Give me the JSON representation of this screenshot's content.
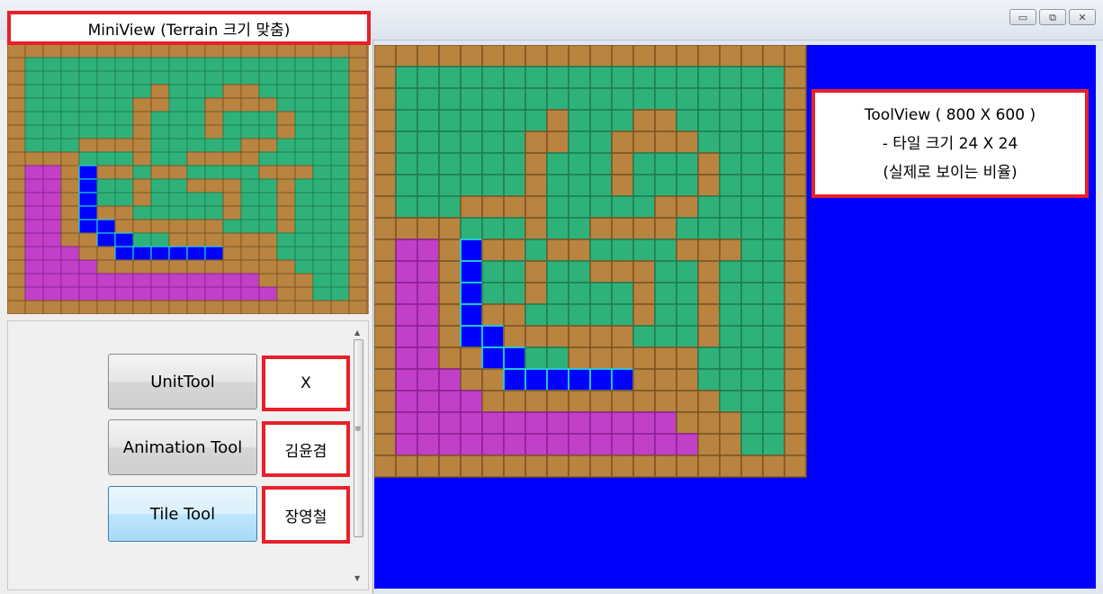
{
  "window": {
    "minimize_glyph": "▭",
    "restore_glyph": "⧉",
    "close_glyph": "✕"
  },
  "mini_label": "MiniView (Terrain 크기 맞춤)",
  "tool_view_label": {
    "line1": "ToolView ( 800 X 600 )",
    "line2": "- 타일 크기 24 X 24",
    "line3": "(실제로 보이는 비율)"
  },
  "tools": [
    {
      "label": "UnitTool",
      "owner": "X",
      "active": false
    },
    {
      "label": "Animation Tool",
      "owner": "김윤겸",
      "active": false
    },
    {
      "label": "Tile Tool",
      "owner": "장영철",
      "active": true
    }
  ],
  "map": {
    "cols": 20,
    "rows": 20,
    "rows_data": [
      "DDDDDDDDDDDDDDDDDDDD",
      "DGGGGGGGGGGGGGGGGGGD",
      "DGGGGGGGGGGGGGGGGGGD",
      "DGGGGGGGDGGGDDGGGGGD",
      "DGGGGGGDDGGDDDDGGGGD",
      "DGGGGGGDGGGDGGGDGGGD",
      "DGGGGGGDGGGDGGGDGGGD",
      "DGGGDDDDGGGGGDDGGGGD",
      "DDDDGGGDGGDDDDGGGGGD",
      "DMMDBDDGDDGGGGDDDGGD",
      "DMMDBGGDGGDDDGGDGGGD",
      "DMMDBGGDGGGGDGGDGGGD",
      "DMMDBDDGGGGGDGGDGGGD",
      "DMMDBBDDDDDDGGGDGGGD",
      "DMMDDBBGGDDDDDDGGGGD",
      "DMMMDDBBBBBBDDDGGGGD",
      "DMMMMDDDDDDDDDDDGGGD",
      "DMMMMMMMMMMMMMDDDGGD",
      "DMMMMMMMMMMMMMMDDGGD",
      "DDDDDDDDDDDDDDDDDDDD"
    ]
  },
  "colors": {
    "dirt": "#b9843f",
    "dirt_dark": "#7a5424",
    "grass": "#2fb27a",
    "grass_dark": "#1e7d52",
    "magenta": "#c23fc8",
    "magenta_dark": "#8a2092",
    "blue": "#0000ff",
    "blue_outline": "#22d1d1",
    "label_border": "#e8202a"
  }
}
